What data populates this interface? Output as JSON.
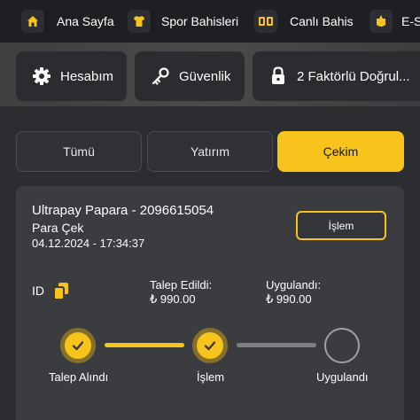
{
  "nav": {
    "items": [
      {
        "label": "Ana Sayfa",
        "icon": "home-icon"
      },
      {
        "label": "Spor Bahisleri",
        "icon": "jersey-icon"
      },
      {
        "label": "Canlı Bahis",
        "icon": "scoreboard-icon"
      },
      {
        "label": "E-S",
        "icon": "esports-icon"
      }
    ]
  },
  "account": {
    "buttons": [
      {
        "label": "Hesabım",
        "icon": "gear-icon"
      },
      {
        "label": "Güvenlik",
        "icon": "key-icon"
      },
      {
        "label": "2 Faktörlü Doğrul...",
        "icon": "lock-icon"
      }
    ]
  },
  "tabs": {
    "items": [
      {
        "label": "Tümü",
        "active": false
      },
      {
        "label": "Yatırım",
        "active": false
      },
      {
        "label": "Çekim",
        "active": true
      }
    ]
  },
  "transaction": {
    "title": "Ultrapay Papara - 2096615054",
    "type": "Para Çek",
    "date": "04.12.2024 - 17:34:37",
    "action_label": "İşlem",
    "id_label": "ID",
    "requested_label": "Talep Edildi:",
    "requested_value": "₺ 990.00",
    "applied_label": "Uygulandı:",
    "applied_value": "₺ 990.00"
  },
  "progress": {
    "steps": [
      {
        "label": "Talep Alındı",
        "done": true
      },
      {
        "label": "İşlem",
        "done": true
      },
      {
        "label": "Uygulandı",
        "done": false
      }
    ]
  },
  "colors": {
    "accent": "#f8c31b",
    "background": "#2b2d31",
    "card": "#3a3c40",
    "nav": "#1e1f22"
  }
}
